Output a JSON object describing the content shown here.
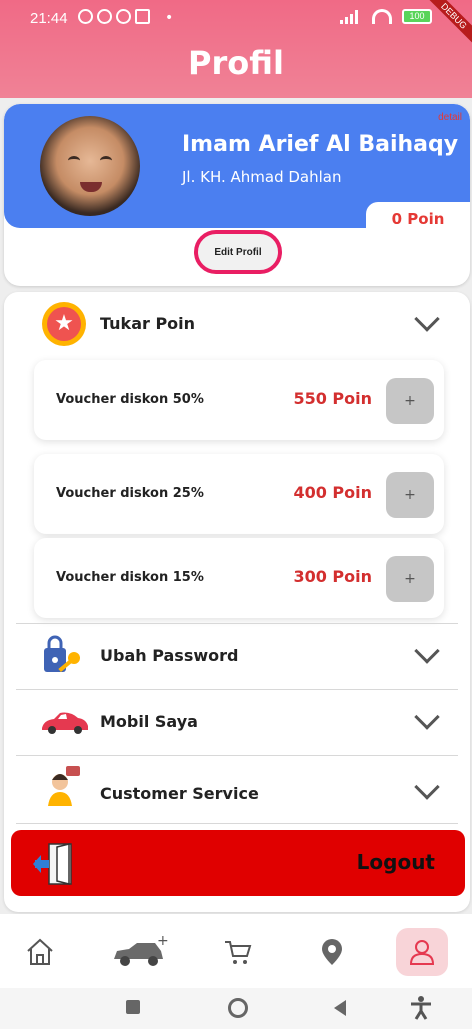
{
  "status_bar": {
    "time": "21:44",
    "battery": "100",
    "debug_label": "DEBUG"
  },
  "app_bar": {
    "title": "Profil"
  },
  "profile": {
    "name": "Imam Arief Al Baihaqy",
    "address": "Jl. KH. Ahmad Dahlan",
    "detail_link": "detail",
    "points": "0 Poin",
    "edit_button": "Edit Profil"
  },
  "sections": {
    "tukar_poin": {
      "label": "Tukar Poin",
      "icon": "star-badge-icon",
      "vouchers": [
        {
          "name": "Voucher diskon 50%",
          "points": "550 Poin",
          "action": "+"
        },
        {
          "name": "Voucher diskon 25%",
          "points": "400 Poin",
          "action": "+"
        },
        {
          "name": "Voucher diskon 15%",
          "points": "300 Poin",
          "action": "+"
        }
      ]
    },
    "ubah_password": {
      "label": "Ubah Password",
      "icon": "lock-key-icon"
    },
    "mobil_saya": {
      "label": "Mobil Saya",
      "icon": "car-icon"
    },
    "customer_service": {
      "label": "Customer Service",
      "icon": "support-agent-icon"
    }
  },
  "logout": {
    "label": "Logout",
    "icon": "exit-door-icon"
  },
  "bottom_nav": [
    {
      "name": "home-icon"
    },
    {
      "name": "add-car-icon"
    },
    {
      "name": "cart-icon"
    },
    {
      "name": "location-icon"
    },
    {
      "name": "profile-icon",
      "active": true
    }
  ],
  "colors": {
    "app_bar": "#f07a90",
    "banner": "#4b7ff0",
    "accent_red": "#d32f2f",
    "logout_bg": "#e00000",
    "edit_border": "#e91e63"
  }
}
